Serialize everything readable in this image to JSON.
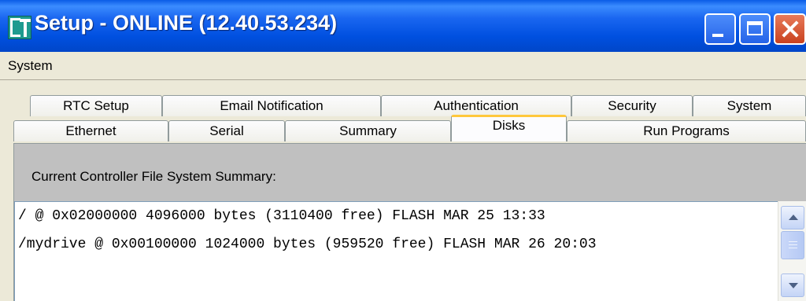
{
  "window": {
    "title": "Setup - ONLINE (12.40.53.234)"
  },
  "menu": {
    "items": [
      "System"
    ]
  },
  "tabs": {
    "row1": [
      "RTC Setup",
      "Email Notification",
      "Authentication",
      "Security",
      "System"
    ],
    "row2": [
      "Ethernet",
      "Serial",
      "Summary",
      "Disks",
      "Run Programs"
    ],
    "selected": "Disks"
  },
  "panel": {
    "header": "Current Controller File System Summary:",
    "lines": [
      "/ @ 0x02000000 4096000 bytes (3110400 free) FLASH MAR 25 13:33",
      "/mydrive @ 0x00100000 1024000 bytes (959520 free) FLASH MAR 26 20:03"
    ]
  },
  "colors": {
    "titlebar": "#0050e0",
    "selected_tab_accent": "#ffc83c",
    "header_strip": "#c0c0c0"
  },
  "icons": [
    "app-icon",
    "minimize-icon",
    "maximize-icon",
    "close-icon",
    "scroll-up-icon",
    "scroll-down-icon"
  ]
}
